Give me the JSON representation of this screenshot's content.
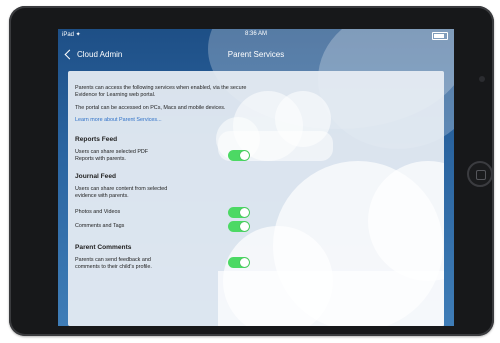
{
  "status": {
    "carrier": "iPad ✦",
    "time": "8:36 AM"
  },
  "nav": {
    "back_label": "Cloud Admin",
    "title": "Parent Services"
  },
  "intro": {
    "paragraph1": "Parents can access the following services when enabled, via the secure Evidence for Learning web portal.",
    "paragraph2": "The portal can be accessed on PCs, Macs and mobile devices.",
    "link": "Learn more about Parent Services..."
  },
  "reports_feed": {
    "title": "Reports Feed",
    "description": "Users can share selected PDF Reports with parents.",
    "enabled": true
  },
  "journal_feed": {
    "title": "Journal Feed",
    "description": "Users can share content from selected evidence with parents.",
    "photos_label": "Photos and Videos",
    "photos_enabled": true,
    "comments_label": "Comments and Tags",
    "comments_enabled": true
  },
  "parent_comments": {
    "title": "Parent Comments",
    "description": "Parents can send feedback and comments to their child's profile.",
    "enabled": true
  },
  "colors": {
    "nav_blue": "#1e4f86",
    "toggle_on": "#4cd964",
    "link_blue": "#2f70c8"
  }
}
